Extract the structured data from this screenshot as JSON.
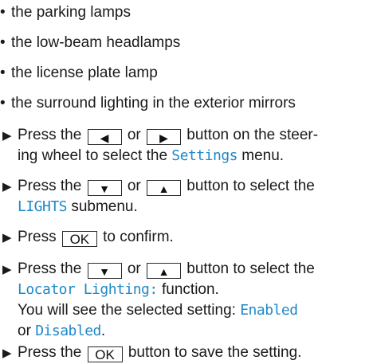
{
  "bullets": [
    "the parking lamps",
    "the low-beam headlamps",
    "the license plate lamp",
    "the surround lighting in the exterior mirrors"
  ],
  "bullet_glyph": "•",
  "step_glyph": "▶",
  "keys": {
    "left": "◀",
    "right": "▶",
    "down": "▼",
    "up": "▲",
    "ok": "OK"
  },
  "steps": {
    "s1": {
      "a": "Press the",
      "or": "or",
      "b": "button on the steer-",
      "c": "ing wheel to select the",
      "menu": "Settings",
      "d": "menu."
    },
    "s2": {
      "a": "Press the",
      "or": "or",
      "b": "button to select the",
      "menu": "LIGHTS",
      "c": "submenu."
    },
    "s3": {
      "a": "Press",
      "b": "to confirm."
    },
    "s4": {
      "a": "Press the",
      "or": "or",
      "b": "button to select the",
      "func": "Locator Lighting:",
      "c": "function.",
      "d": "You will see the selected setting:",
      "enabled": "Enabled",
      "or2": "or",
      "disabled": "Disabled",
      "end": "."
    },
    "s5": {
      "a": "Press the",
      "b": "button to save the setting."
    }
  },
  "colors": {
    "display_text": "#1f88c9",
    "body_text": "#1a1a1a"
  }
}
